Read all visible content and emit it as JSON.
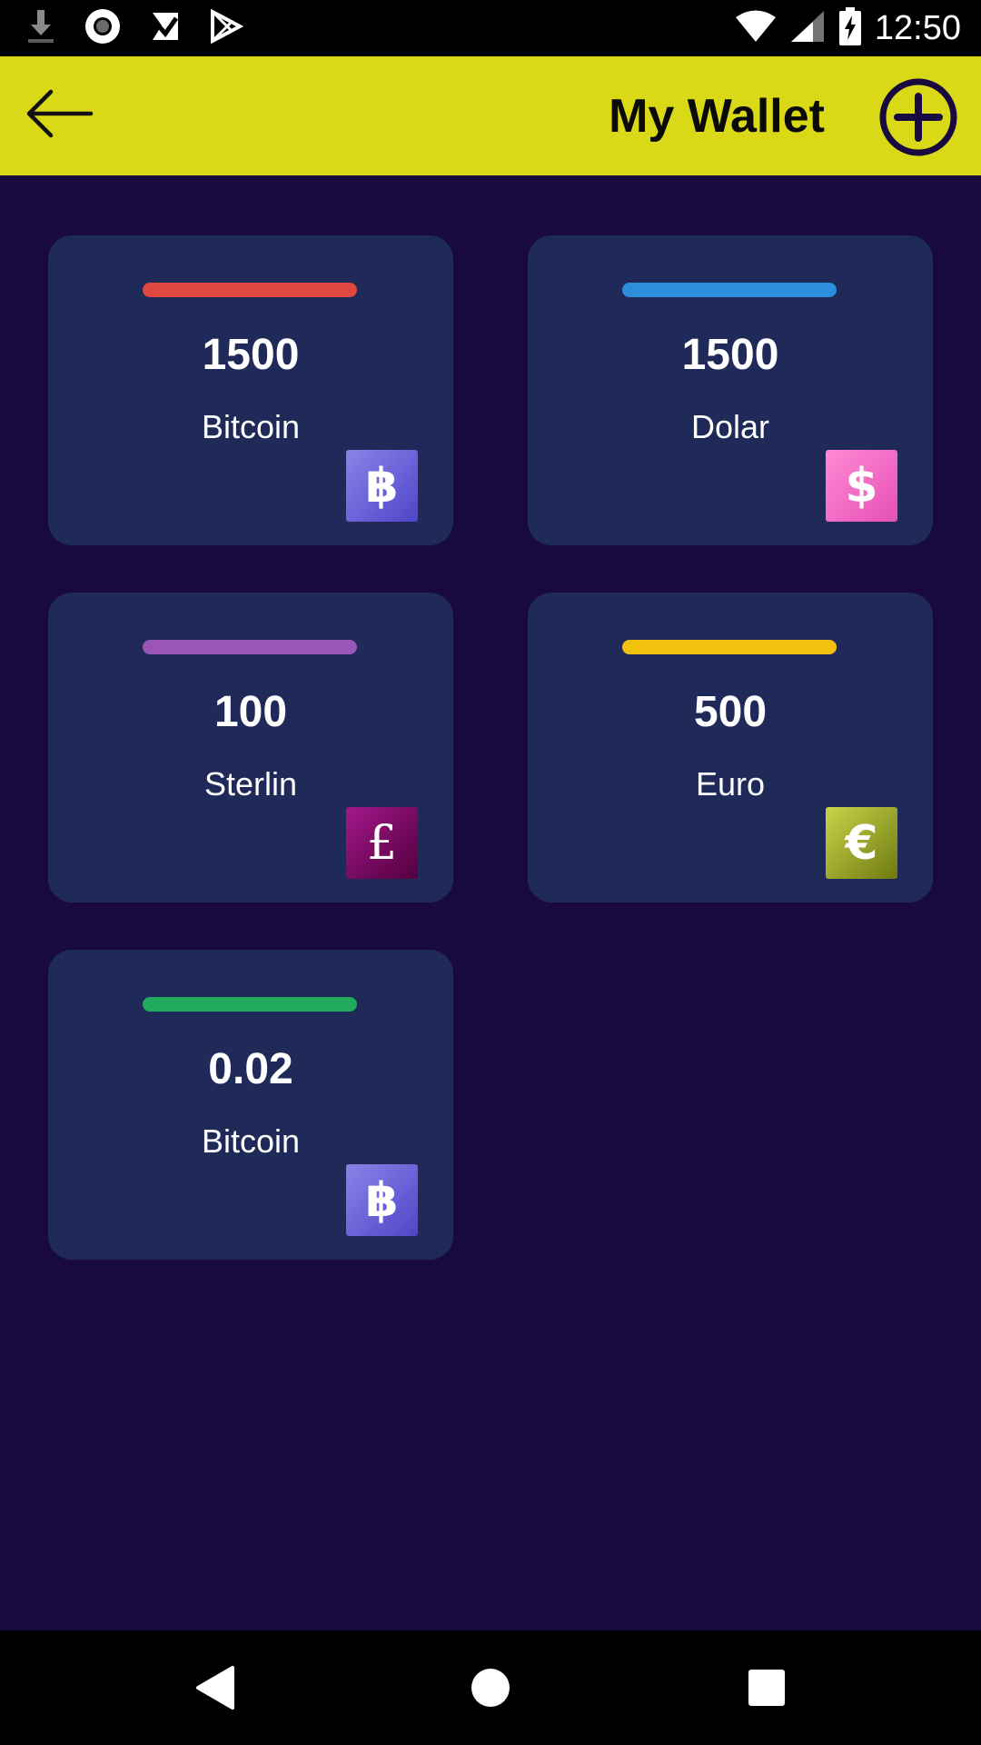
{
  "status_bar": {
    "time": "12:50",
    "left_icons": [
      "download-icon",
      "circle-record-icon",
      "inbox-check-icon",
      "play-store-icon"
    ],
    "right_icons": [
      "wifi-icon",
      "signal-icon",
      "battery-charging-icon"
    ]
  },
  "app_bar": {
    "title": "My Wallet",
    "back_icon": "arrow-left-icon",
    "add_icon": "plus-circle-icon",
    "background": "#dad918",
    "add_color": "#180a3e"
  },
  "wallets": [
    {
      "amount": "1500",
      "name": "Bitcoin",
      "bar_color": "#e0473e",
      "icon": "bitcoin-icon",
      "symbol": "฿",
      "icon_colors": [
        "#8a84e8",
        "#4f45c8"
      ]
    },
    {
      "amount": "1500",
      "name": "Dolar",
      "bar_color": "#2d8fdc",
      "icon": "dollar-icon",
      "symbol": "$",
      "icon_colors": [
        "#ff8ad6",
        "#e650b4"
      ]
    },
    {
      "amount": "100",
      "name": "Sterlin",
      "bar_color": "#9b55b8",
      "icon": "pound-icon",
      "symbol": "£",
      "icon_colors": [
        "#a3188a",
        "#52003d"
      ]
    },
    {
      "amount": "500",
      "name": "Euro",
      "bar_color": "#f2c10f",
      "icon": "euro-icon",
      "symbol": "€",
      "icon_colors": [
        "#c9d44a",
        "#6f7a10"
      ]
    },
    {
      "amount": "0.02",
      "name": "Bitcoin",
      "bar_color": "#20aa5e",
      "icon": "bitcoin-icon",
      "symbol": "฿",
      "icon_colors": [
        "#8a84e8",
        "#4f45c8"
      ]
    }
  ],
  "nav_bar": {
    "back_icon": "nav-back-icon",
    "home_icon": "nav-home-icon",
    "recents_icon": "nav-recents-icon"
  },
  "theme": {
    "background": "#180a3e",
    "card_background": "#1f2a58"
  }
}
